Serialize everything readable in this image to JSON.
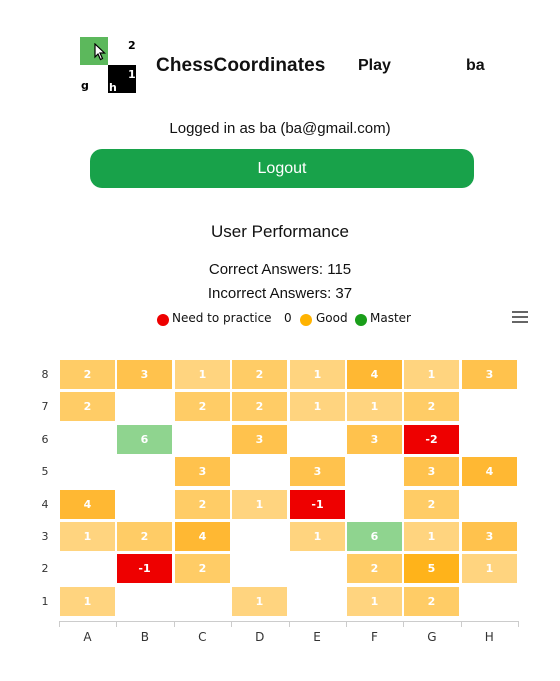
{
  "header": {
    "logo": {
      "top_right": "2",
      "bottom_left": "g",
      "bottom_mid": "h",
      "bottom_right": "1"
    },
    "brand": "ChessCoordinates",
    "nav_play": "Play",
    "nav_user": "ba"
  },
  "account": {
    "logged_in_text": "Logged in as ba (ba@gmail.com)",
    "logout_label": "Logout"
  },
  "performance": {
    "title": "User Performance",
    "correct_text": "Correct Answers: 115",
    "incorrect_text": "Incorrect Answers: 37"
  },
  "legend": {
    "items": [
      {
        "label": "Need to practice",
        "color": "#ee0000"
      },
      {
        "label": "0",
        "color": ""
      },
      {
        "label": "Good",
        "color": "#ffb300"
      },
      {
        "label": "Master",
        "color": "#1a9e1a"
      }
    ]
  },
  "chart_data": {
    "type": "heatmap",
    "x_categories": [
      "A",
      "B",
      "C",
      "D",
      "E",
      "F",
      "G",
      "H"
    ],
    "y_categories": [
      "8",
      "7",
      "6",
      "5",
      "4",
      "3",
      "2",
      "1"
    ],
    "cells": [
      {
        "x": "A",
        "y": "8",
        "value": 2
      },
      {
        "x": "B",
        "y": "8",
        "value": 3
      },
      {
        "x": "C",
        "y": "8",
        "value": 1
      },
      {
        "x": "D",
        "y": "8",
        "value": 2
      },
      {
        "x": "E",
        "y": "8",
        "value": 1
      },
      {
        "x": "F",
        "y": "8",
        "value": 4
      },
      {
        "x": "G",
        "y": "8",
        "value": 1
      },
      {
        "x": "H",
        "y": "8",
        "value": 3
      },
      {
        "x": "A",
        "y": "7",
        "value": 2
      },
      {
        "x": "C",
        "y": "7",
        "value": 2
      },
      {
        "x": "D",
        "y": "7",
        "value": 2
      },
      {
        "x": "E",
        "y": "7",
        "value": 1
      },
      {
        "x": "F",
        "y": "7",
        "value": 1
      },
      {
        "x": "G",
        "y": "7",
        "value": 2
      },
      {
        "x": "B",
        "y": "6",
        "value": 6
      },
      {
        "x": "D",
        "y": "6",
        "value": 3
      },
      {
        "x": "F",
        "y": "6",
        "value": 3
      },
      {
        "x": "G",
        "y": "6",
        "value": -2
      },
      {
        "x": "C",
        "y": "5",
        "value": 3
      },
      {
        "x": "E",
        "y": "5",
        "value": 3
      },
      {
        "x": "G",
        "y": "5",
        "value": 3
      },
      {
        "x": "H",
        "y": "5",
        "value": 4
      },
      {
        "x": "A",
        "y": "4",
        "value": 4
      },
      {
        "x": "C",
        "y": "4",
        "value": 2
      },
      {
        "x": "D",
        "y": "4",
        "value": 1
      },
      {
        "x": "E",
        "y": "4",
        "value": -1
      },
      {
        "x": "G",
        "y": "4",
        "value": 2
      },
      {
        "x": "A",
        "y": "3",
        "value": 1
      },
      {
        "x": "B",
        "y": "3",
        "value": 2
      },
      {
        "x": "C",
        "y": "3",
        "value": 4
      },
      {
        "x": "E",
        "y": "3",
        "value": 1
      },
      {
        "x": "F",
        "y": "3",
        "value": 6
      },
      {
        "x": "G",
        "y": "3",
        "value": 1
      },
      {
        "x": "H",
        "y": "3",
        "value": 3
      },
      {
        "x": "B",
        "y": "2",
        "value": -1
      },
      {
        "x": "C",
        "y": "2",
        "value": 2
      },
      {
        "x": "F",
        "y": "2",
        "value": 2
      },
      {
        "x": "G",
        "y": "2",
        "value": 5
      },
      {
        "x": "H",
        "y": "2",
        "value": 1
      },
      {
        "x": "A",
        "y": "1",
        "value": 1
      },
      {
        "x": "D",
        "y": "1",
        "value": 1
      },
      {
        "x": "F",
        "y": "1",
        "value": 1
      },
      {
        "x": "G",
        "y": "1",
        "value": 2
      }
    ],
    "color_scale": {
      "negative": "#ee0000",
      "master": "#8fd48f"
    }
  }
}
